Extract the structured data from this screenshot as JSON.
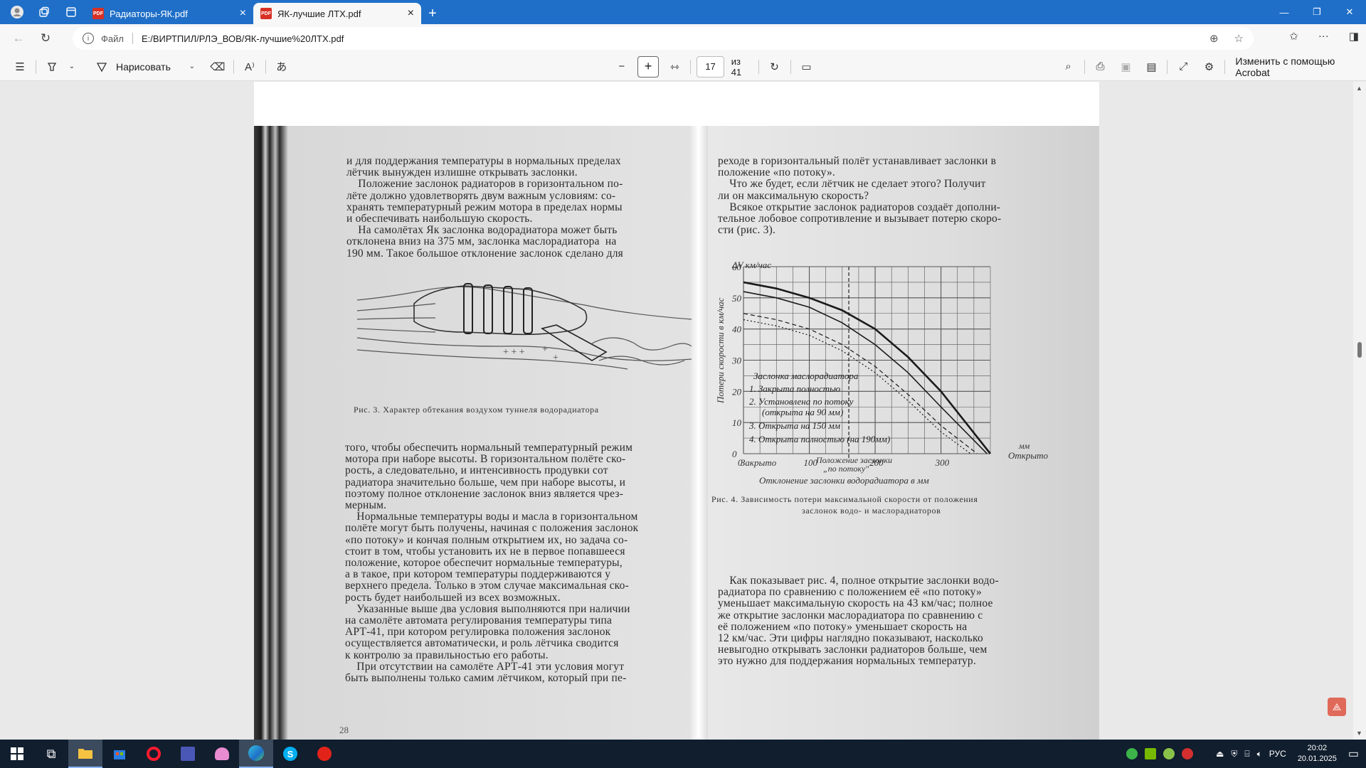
{
  "browser": {
    "tabs": [
      {
        "title": "Радиаторы-ЯК.pdf",
        "active": false
      },
      {
        "title": "ЯК-лучшие ЛТХ.pdf",
        "active": true
      }
    ],
    "address": {
      "scheme_label": "Файл",
      "url": "E:/ВИРТПИЛ/РЛЭ_ВОВ/ЯК-лучшие%20ЛТХ.pdf"
    }
  },
  "pdf_toolbar": {
    "draw_label": "Нарисовать",
    "page_current": "17",
    "page_total_label": "из 41",
    "acrobat_label": "Изменить с помощью Acrobat"
  },
  "document": {
    "left_page": {
      "text_top": "и для поддержания температуры в нормальных пределах\nлётчик вынужден излишне открывать заслонки.\n    Положение заслонок радиаторов в горизонтальном по-\nлёте должно удовлетворять двум важным условиям: со-\nхранять температурный режим мотора в пределах нормы\nи обеспечивать наибольшую скорость.\n    На самолётах Як заслонка водорадиатора может быть\nотклонена вниз на 375 мм, заслонка маслорадиатора  на\n190 мм. Такое большое отклонение заслонок сделано для",
      "figure_caption": "Рис. 3. Характер обтекания воздухом туннеля водорадиатора",
      "text_bottom": "того, чтобы обеспечить нормальный температурный режим\nмотора при наборе высоты. В горизонтальном полёте ско-\nрость, а следовательно, и интенсивность продувки сот\nрадиатора значительно больше, чем при наборе высоты, и\nпоэтому полное отклонение заслонок вниз является чрез-\nмерным.\n    Нормальные температуры воды и масла в горизонтальном\nполёте могут быть получены, начиная с положения заслонок\n«по потоку» и кончая полным открытием их, но задача со-\nстоит в том, чтобы установить их не в первое попавшееся\nположение, которое обеспечит нормальные температуры,\nа в такое, при котором температуры поддерживаются у\nверхнего предела. Только в этом случае максимальная ско-\nрость будет наибольшей из всех возможных.\n    Указанные выше два условия выполняются при наличии\nна самолёте автомата регулирования температуры типа\nАРТ-41, при котором регулировка положения заслонок\nосуществляется автоматически, и роль лётчика сводится\nк контролю за правильностью его работы.\n    При отсутствии на самолёте АРТ-41 эти условия могут\nбыть выполнены только самим лётчиком, который при пе-",
      "page_number": "28"
    },
    "right_page": {
      "text_top": "реходе в горизонтальный полёт устанавливает заслонки в\nположение «по потоку».\n    Что же будет, если лётчик не сделает этого? Получит\nли он максимальную скорость?\n    Всякое открытие заслонок радиаторов создаёт дополни-\nтельное лобовое сопротивление и вызывает потерю скоро-\nсти (рис. 3).",
      "figure_caption_line1": "Рис. 4. Зависимость потери максимальной скорости от положения",
      "figure_caption_line2": "заслонок водо- и маслорадиаторов",
      "text_bottom": "    Как показывает рис. 4, полное открытие заслонки водо-\nрадиатора по сравнению с положением её «по потоку»\nуменьшает максимальную скорость на 43 км/час; полное\nже открытие заслонки маслорадиатора по сравнению с\nеё положением «по потоку» уменьшает скорость на\n12 км/час. Эти цифры наглядно показывают, насколько\nневыгодно открывать заслонки радиаторов больше, чем\nэто нужно для поддержания нормальных температур."
    },
    "chart": {
      "y_label": "Потери скорости в км/час",
      "y_unit": "ΔV км/час",
      "x_label": "Отклонение заслонки водорадиатора в мм",
      "x_unit": "мм",
      "x_ticks": [
        "0",
        "100",
        "200",
        "300"
      ],
      "y_ticks": [
        "0",
        "10",
        "20",
        "30",
        "40",
        "50",
        "60"
      ],
      "x_left_label": "Закрыто",
      "x_right_label": "Открыто",
      "flow_label_line1": "Положение заслонки",
      "flow_label_line2": "„по потоку\"",
      "legend_title": "Заслонка маслорадиатора",
      "legend_items": [
        "1. Закрыта полностью",
        "2. Установлена по потоку",
        "(открыта на 90 мм)",
        "3. Открыта на 150 мм",
        "4. Открыта полностью (на 190мм)"
      ]
    },
    "chart_data": {
      "type": "line",
      "xlabel": "Отклонение заслонки водорадиатора в мм",
      "ylabel": "Потери скорости в км/час",
      "xlim": [
        0,
        375
      ],
      "ylim": [
        0,
        60
      ],
      "series": [
        {
          "name": "Открыта полностью (на 190мм)",
          "x": [
            0,
            50,
            100,
            150,
            200,
            250,
            300,
            375
          ],
          "y": [
            55,
            53,
            50,
            46,
            40,
            31,
            20,
            0
          ]
        },
        {
          "name": "Открыта на 150 мм",
          "x": [
            0,
            50,
            100,
            150,
            200,
            250,
            300,
            370
          ],
          "y": [
            52,
            50,
            47,
            42,
            35,
            26,
            15,
            0
          ]
        },
        {
          "name": "Установлена по потоку (открыта на 90 мм)",
          "x": [
            0,
            50,
            100,
            150,
            200,
            250,
            300,
            355
          ],
          "y": [
            45,
            43,
            40,
            35,
            28,
            19,
            9,
            0
          ]
        },
        {
          "name": "Закрыта полностью",
          "x": [
            0,
            50,
            100,
            150,
            200,
            250,
            300,
            345
          ],
          "y": [
            43,
            41,
            38,
            33,
            26,
            17,
            7,
            0
          ]
        }
      ]
    }
  },
  "taskbar": {
    "lang": "РУС",
    "time": "20:02",
    "date": "20.01.2025"
  }
}
